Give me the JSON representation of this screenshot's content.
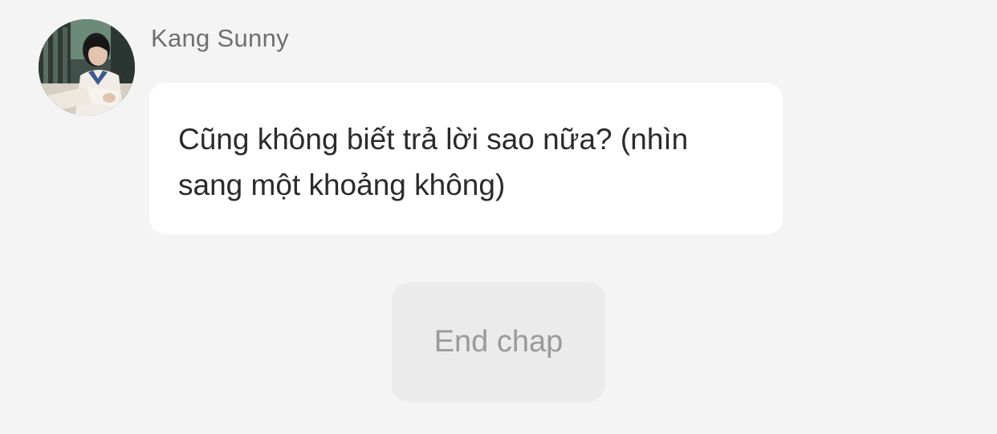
{
  "message": {
    "sender": "Kang Sunny",
    "text": "Cũng không biết trả lời sao nữa? (nhìn sang một khoảng không)"
  },
  "end_chap": {
    "label": "End chap"
  },
  "icons": {
    "avatar": "profile-photo"
  },
  "colors": {
    "background": "#f4f4f4",
    "bubble": "#ffffff",
    "button": "#ebebeb",
    "name_text": "#6f6f6f",
    "button_text": "#9a9a9a"
  }
}
